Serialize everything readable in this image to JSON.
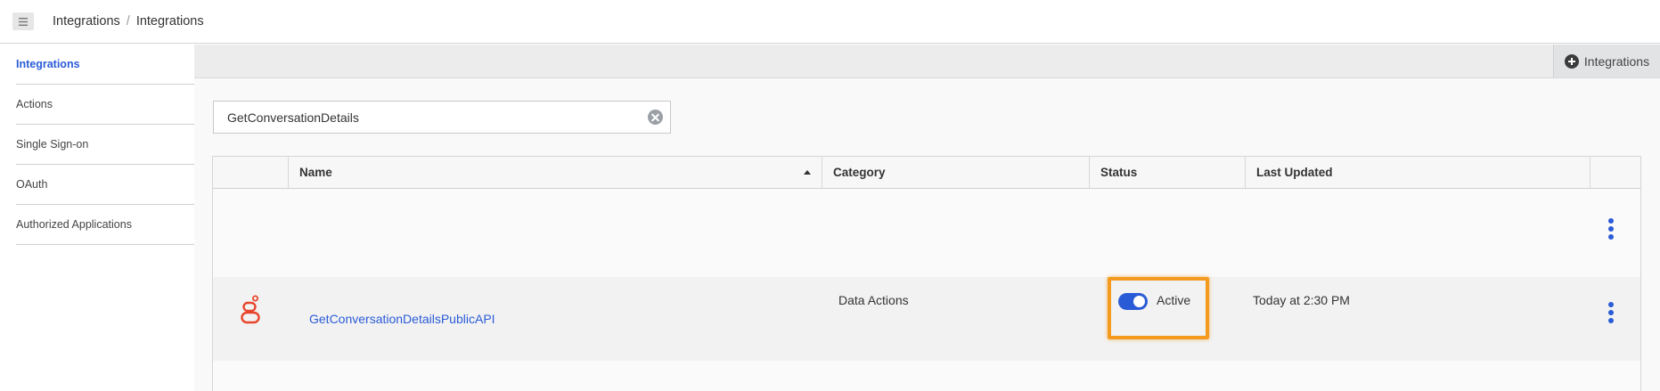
{
  "breadcrumb": {
    "first": "Integrations",
    "separator": "/",
    "current": "Integrations"
  },
  "sidebar": {
    "items": [
      {
        "label": "Integrations",
        "active": true
      },
      {
        "label": "Actions"
      },
      {
        "label": "Single Sign-on"
      },
      {
        "label": "OAuth"
      },
      {
        "label": "Authorized Applications"
      }
    ]
  },
  "toolbar": {
    "add_label": "Integrations",
    "add_icon": "plus-circle-icon"
  },
  "search": {
    "value": "GetConversationDetails",
    "clear_icon": "clear-icon"
  },
  "table": {
    "columns": [
      "",
      "Name",
      "Category",
      "Status",
      "Last Updated",
      ""
    ],
    "sorted_column": "Name",
    "sort_direction": "ascending",
    "rows": [
      {
        "logo_icon": "genesys-logo-icon",
        "name": "GetConversationDetailsPublicAPI",
        "category": "Data Actions",
        "status": "Active",
        "status_on": true,
        "last_updated": "Today at 2:30 PM"
      }
    ]
  },
  "colors": {
    "accent": "#2a5bd7",
    "highlight": "#f39a1f",
    "logo": "#e8462c"
  }
}
